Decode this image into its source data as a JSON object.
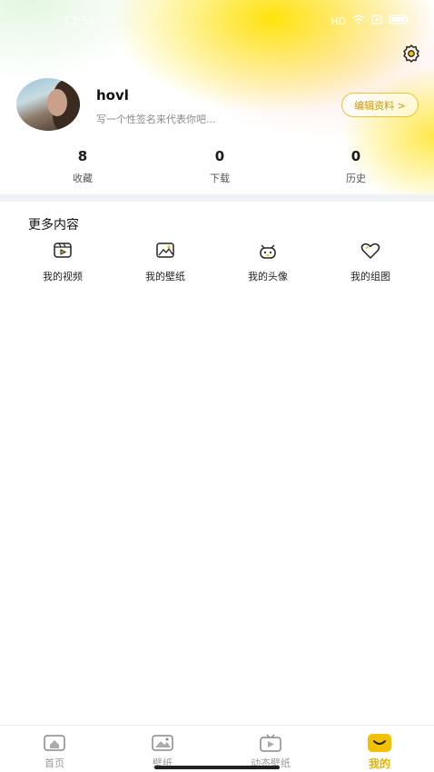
{
  "status_bar": {
    "time": "13:54",
    "icons": [
      "hd-icon",
      "wifi-icon",
      "screen-icon",
      "battery-icon"
    ]
  },
  "profile": {
    "username": "hovl",
    "signature": "写一个性签名来代表你吧...",
    "edit_label": "编辑资料 >"
  },
  "stats": [
    {
      "value": "8",
      "label": "收藏"
    },
    {
      "value": "0",
      "label": "下载"
    },
    {
      "value": "0",
      "label": "历史"
    }
  ],
  "more": {
    "title": "更多内容",
    "items": [
      {
        "label": "我的视频",
        "icon": "video-icon"
      },
      {
        "label": "我的壁纸",
        "icon": "image-icon"
      },
      {
        "label": "我的头像",
        "icon": "avatar-icon"
      },
      {
        "label": "我的组图",
        "icon": "heart-icon"
      }
    ]
  },
  "nav": {
    "items": [
      {
        "label": "首页",
        "icon": "home-icon",
        "active": false
      },
      {
        "label": "壁纸",
        "icon": "wallpaper-icon",
        "active": false
      },
      {
        "label": "动态壁纸",
        "icon": "tv-icon",
        "active": false
      },
      {
        "label": "我的",
        "icon": "smile-icon",
        "active": true
      }
    ]
  },
  "colors": {
    "accent": "#e2b400",
    "edit_border": "#e8c23a",
    "nav_inactive": "#999999",
    "band": "#f1f2f6"
  }
}
